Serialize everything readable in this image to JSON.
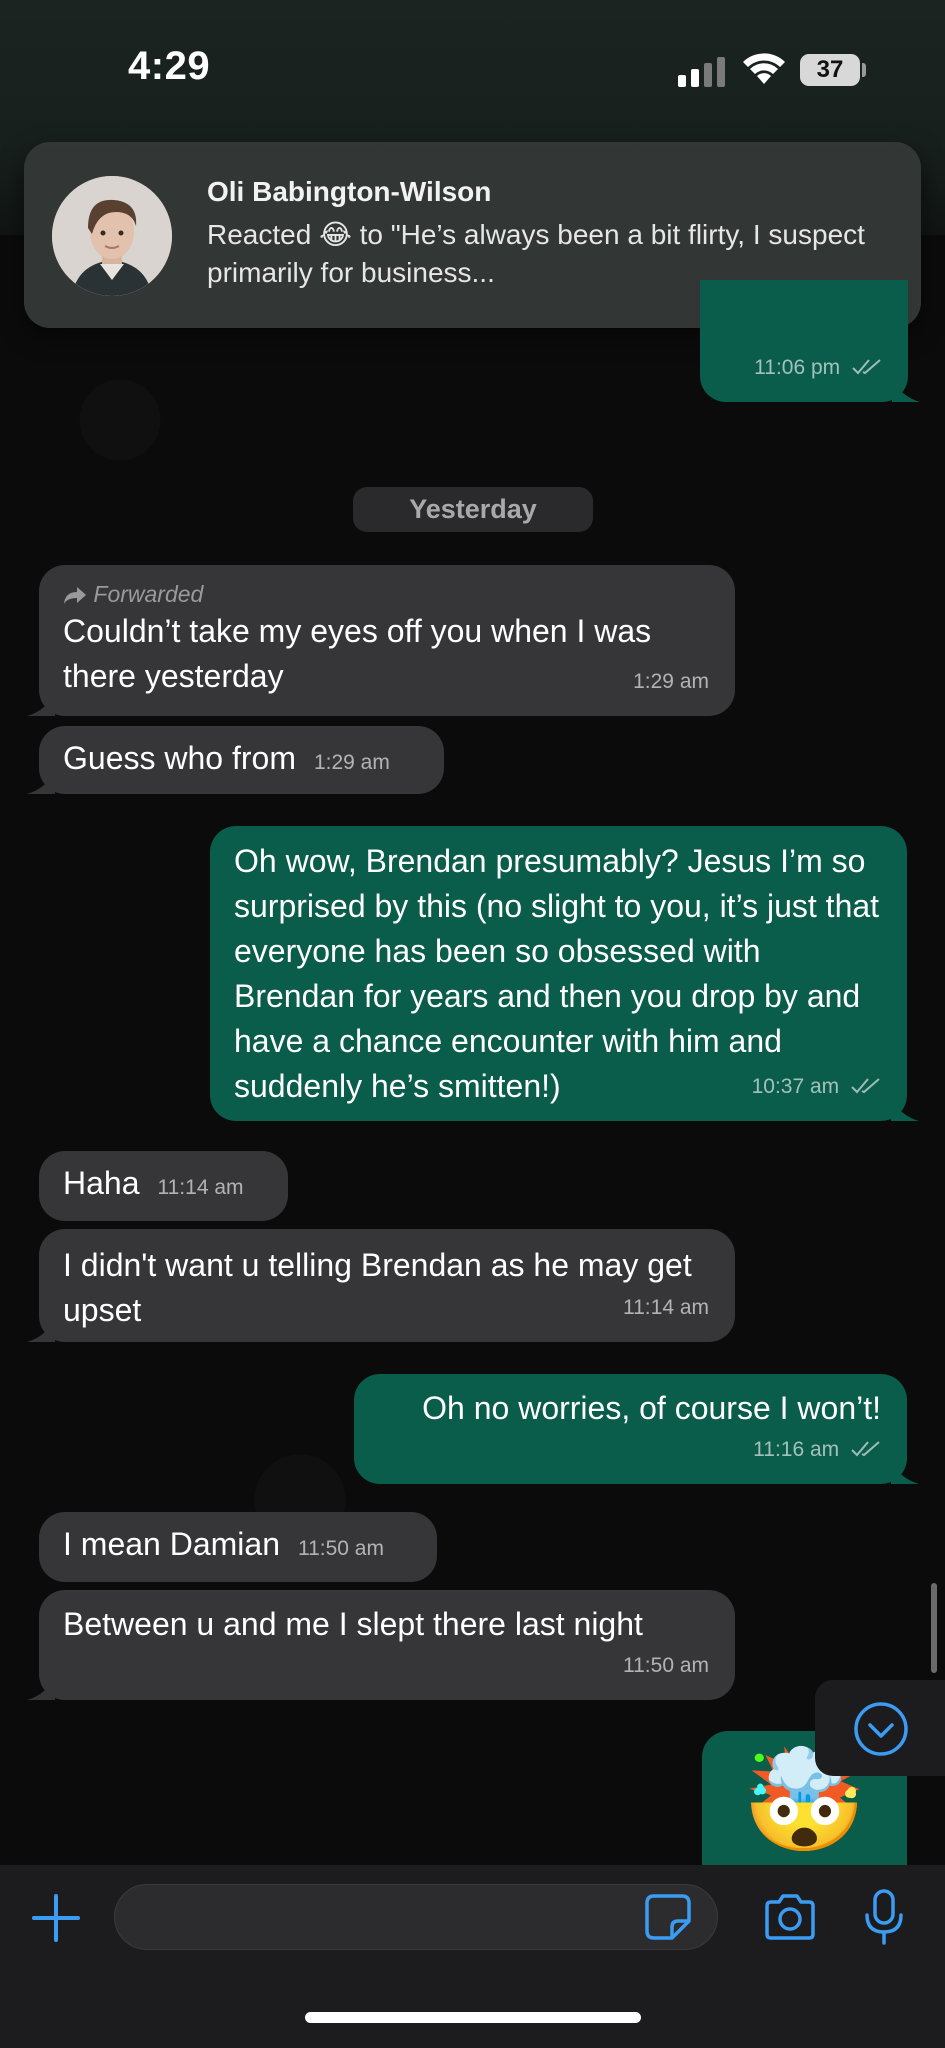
{
  "status_bar": {
    "time": "4:29",
    "battery": "37"
  },
  "notification": {
    "sender": "Oli Babington-Wilson",
    "body": "Reacted 😂 to \"He’s always been a bit flirty, I suspect primarily for business..."
  },
  "previous_message": {
    "time": "11:06 pm"
  },
  "date_separator": "Yesterday",
  "messages": [
    {
      "direction": "in",
      "forwarded_label": "Forwarded",
      "text": "Couldn’t take my eyes off you when I was there yesterday",
      "time": "1:29 am"
    },
    {
      "direction": "in",
      "text": "Guess who from",
      "time": "1:29 am"
    },
    {
      "direction": "out",
      "text": "Oh wow, Brendan presumably? Jesus I’m so surprised by this (no slight to you, it’s just that everyone has been so obsessed with Brendan for years and then you drop by and have a chance encounter with him and suddenly he’s smitten!)",
      "time": "10:37 am"
    },
    {
      "direction": "in",
      "text": "Haha",
      "time": "11:14 am"
    },
    {
      "direction": "in",
      "text": "I didn't want u telling Brendan as he may get upset",
      "time": "11:14 am"
    },
    {
      "direction": "out",
      "text": "Oh no worries, of course I won’t!",
      "time": "11:16 am"
    },
    {
      "direction": "in",
      "text": "I mean Damian",
      "time": "11:50 am"
    },
    {
      "direction": "in",
      "text": "Between u and me I slept there last night",
      "time": "11:50 am"
    }
  ],
  "last_sent_emoji": "🤯",
  "input": {
    "value": "",
    "placeholder": ""
  },
  "icons": {
    "plus": "plus-icon",
    "sticker": "sticker-icon",
    "camera": "camera-icon",
    "mic": "microphone-icon",
    "scroll_down": "chevron-down-icon"
  },
  "colors": {
    "incoming_bubble": "#363638",
    "outgoing_bubble": "#0a5c4b",
    "accent": "#3b9cf3",
    "background": "#0b0b0b"
  }
}
